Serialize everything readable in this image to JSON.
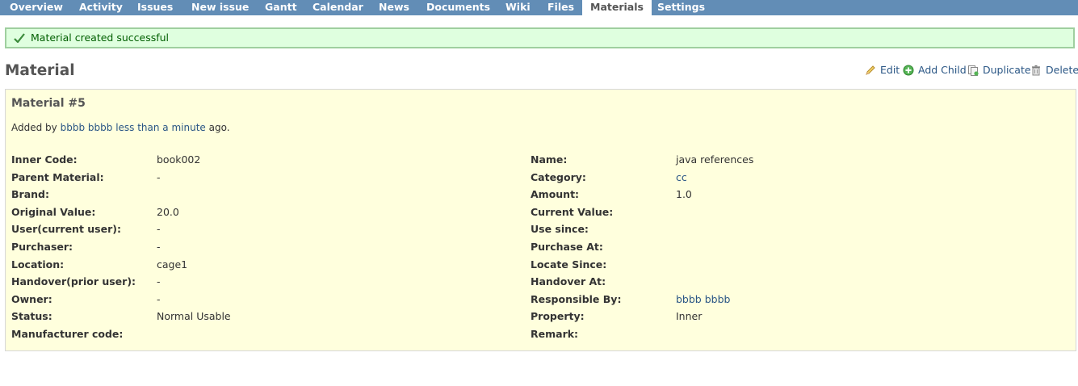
{
  "tabs": [
    {
      "label": "Overview",
      "selected": false
    },
    {
      "label": "Activity",
      "selected": false
    },
    {
      "label": "Issues",
      "selected": false
    },
    {
      "label": "New issue",
      "selected": false
    },
    {
      "label": "Gantt",
      "selected": false
    },
    {
      "label": "Calendar",
      "selected": false
    },
    {
      "label": "News",
      "selected": false
    },
    {
      "label": "Documents",
      "selected": false
    },
    {
      "label": "Wiki",
      "selected": false
    },
    {
      "label": "Files",
      "selected": false
    },
    {
      "label": "Materials",
      "selected": true
    },
    {
      "label": "Settings",
      "selected": false
    }
  ],
  "flash": {
    "message": "Material created successful"
  },
  "page": {
    "title": "Material"
  },
  "actions": {
    "edit": "Edit",
    "add_child": "Add Child",
    "duplicate": "Duplicate",
    "delete": "Delete"
  },
  "material": {
    "heading": "Material #5",
    "added_prefix": "Added by",
    "author": "bbbb bbbb",
    "time_ago": "less than a minute",
    "added_suffix": "ago."
  },
  "fields_left": [
    {
      "label": "Inner Code:",
      "value": "book002",
      "link": false
    },
    {
      "label": "Parent Material:",
      "value": "-",
      "link": false
    },
    {
      "label": "Brand:",
      "value": "",
      "link": false
    },
    {
      "label": "Original Value:",
      "value": "20.0",
      "link": false
    },
    {
      "label": "User(current user):",
      "value": "-",
      "link": false
    },
    {
      "label": "Purchaser:",
      "value": "-",
      "link": false
    },
    {
      "label": "Location:",
      "value": "cage1",
      "link": false
    },
    {
      "label": "Handover(prior user):",
      "value": "-",
      "link": false
    },
    {
      "label": "Owner:",
      "value": "-",
      "link": false
    },
    {
      "label": "Status:",
      "value": "Normal Usable",
      "link": false
    },
    {
      "label": "Manufacturer code:",
      "value": "",
      "link": false
    }
  ],
  "fields_right": [
    {
      "label": "Name:",
      "value": "java references",
      "link": false
    },
    {
      "label": "Category:",
      "value": "cc",
      "link": true
    },
    {
      "label": "Amount:",
      "value": "1.0",
      "link": false
    },
    {
      "label": "Current Value:",
      "value": "",
      "link": false
    },
    {
      "label": "Use since:",
      "value": "",
      "link": false
    },
    {
      "label": "Purchase At:",
      "value": "",
      "link": false
    },
    {
      "label": "Locate Since:",
      "value": "",
      "link": false
    },
    {
      "label": "Handover At:",
      "value": "",
      "link": false
    },
    {
      "label": "Responsible By:",
      "value": "bbbb bbbb",
      "link": true
    },
    {
      "label": "Property:",
      "value": "Inner",
      "link": false
    },
    {
      "label": "Remark:",
      "value": "",
      "link": false
    }
  ],
  "colors": {
    "tabbar": "#628db6",
    "flash_bg": "#dfffdf",
    "flash_border": "#9fcf9f",
    "panel_bg": "#ffffdd",
    "link": "#2a5685"
  },
  "icons": [
    "check-icon",
    "pencil-icon",
    "add-icon",
    "duplicate-icon",
    "trash-icon"
  ]
}
